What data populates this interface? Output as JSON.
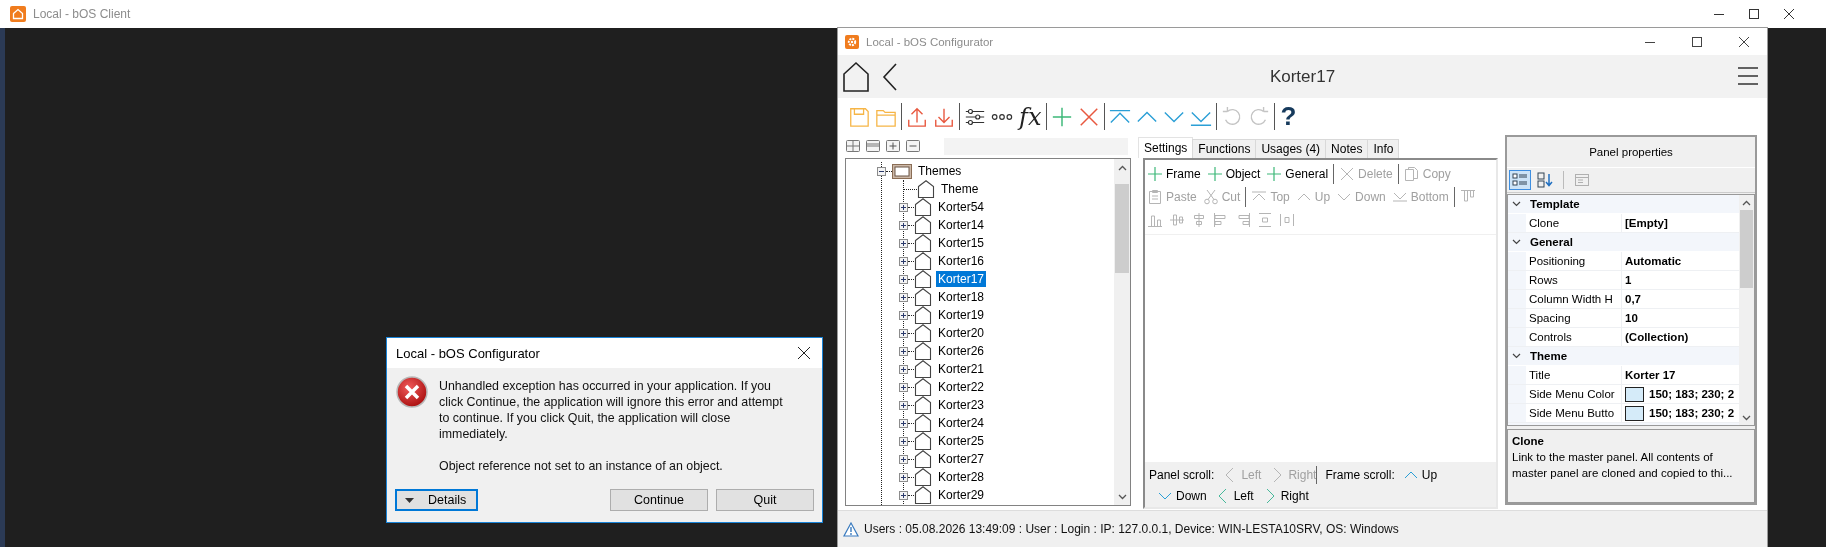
{
  "client_window": {
    "title": "Local - bOS Client"
  },
  "configurator": {
    "title": "Local - bOS Configurator",
    "header": {
      "title": "Korter17"
    },
    "toolbar": [
      [
        {
          "kind": "save",
          "disabled": false
        },
        {
          "kind": "open",
          "disabled": false
        }
      ],
      [
        {
          "kind": "upload",
          "disabled": false
        },
        {
          "kind": "download",
          "disabled": false
        }
      ],
      [
        {
          "kind": "sliders",
          "disabled": false
        },
        {
          "kind": "more",
          "disabled": false
        },
        {
          "kind": "function",
          "label": "fx",
          "disabled": false
        }
      ],
      [
        {
          "kind": "add",
          "disabled": false
        },
        {
          "kind": "remove",
          "disabled": false
        }
      ],
      [
        {
          "kind": "top",
          "disabled": false
        },
        {
          "kind": "up",
          "disabled": false
        },
        {
          "kind": "down",
          "disabled": false
        },
        {
          "kind": "bottom",
          "disabled": false
        }
      ],
      [
        {
          "kind": "undo",
          "disabled": true
        },
        {
          "kind": "redo",
          "disabled": true
        }
      ],
      [
        {
          "kind": "help",
          "label": "?",
          "disabled": false
        }
      ]
    ],
    "tree": [
      {
        "label": "Themes",
        "kind": "group",
        "expanded": true,
        "selected": false,
        "children": [
          {
            "label": "Theme",
            "kind": "panel",
            "selected": false
          },
          {
            "label": "Korter54",
            "kind": "panel",
            "expanded": false,
            "selected": false
          },
          {
            "label": "Korter14",
            "kind": "panel",
            "expanded": false,
            "selected": false
          },
          {
            "label": "Korter15",
            "kind": "panel",
            "expanded": false,
            "selected": false
          },
          {
            "label": "Korter16",
            "kind": "panel",
            "expanded": false,
            "selected": false
          },
          {
            "label": "Korter17",
            "kind": "panel",
            "expanded": false,
            "selected": true
          },
          {
            "label": "Korter18",
            "kind": "panel",
            "expanded": false,
            "selected": false
          },
          {
            "label": "Korter19",
            "kind": "panel",
            "expanded": false,
            "selected": false
          },
          {
            "label": "Korter20",
            "kind": "panel",
            "expanded": false,
            "selected": false
          },
          {
            "label": "Korter26",
            "kind": "panel",
            "expanded": false,
            "selected": false
          },
          {
            "label": "Korter21",
            "kind": "panel",
            "expanded": false,
            "selected": false
          },
          {
            "label": "Korter22",
            "kind": "panel",
            "expanded": false,
            "selected": false
          },
          {
            "label": "Korter23",
            "kind": "panel",
            "expanded": false,
            "selected": false
          },
          {
            "label": "Korter24",
            "kind": "panel",
            "expanded": false,
            "selected": false
          },
          {
            "label": "Korter25",
            "kind": "panel",
            "expanded": false,
            "selected": false
          },
          {
            "label": "Korter27",
            "kind": "panel",
            "expanded": false,
            "selected": false
          },
          {
            "label": "Korter28",
            "kind": "panel",
            "expanded": false,
            "selected": false
          },
          {
            "label": "Korter29",
            "kind": "panel",
            "expanded": false,
            "selected": false
          }
        ]
      }
    ],
    "tabs": [
      {
        "label": "Settings",
        "selected": true
      },
      {
        "label": "Functions",
        "selected": false
      },
      {
        "label": "Usages (4)",
        "selected": false
      },
      {
        "label": "Notes",
        "selected": false
      },
      {
        "label": "Info",
        "selected": false
      }
    ],
    "actions": [
      [
        [
          {
            "kind": "add",
            "label": "Frame",
            "disabled": false
          },
          {
            "kind": "add",
            "label": "Object",
            "disabled": false
          },
          {
            "kind": "add",
            "label": "General",
            "disabled": false
          }
        ],
        [
          {
            "kind": "delete",
            "label": "Delete",
            "disabled": true
          }
        ],
        [
          {
            "kind": "copy",
            "label": "Copy",
            "disabled": true
          }
        ]
      ],
      [
        [
          {
            "kind": "paste",
            "label": "Paste",
            "disabled": true
          },
          {
            "kind": "cut",
            "label": "Cut",
            "disabled": true
          }
        ],
        [
          {
            "kind": "top",
            "label": "Top",
            "disabled": true
          },
          {
            "kind": "up",
            "label": "Up",
            "disabled": true
          },
          {
            "kind": "down",
            "label": "Down",
            "disabled": true
          },
          {
            "kind": "bottom",
            "label": "Bottom",
            "disabled": true
          }
        ],
        [
          {
            "kind": "align-top",
            "disabled": true
          }
        ]
      ],
      [
        [
          {
            "kind": "align-bottom",
            "disabled": true
          },
          {
            "kind": "align-middle",
            "disabled": true
          },
          {
            "kind": "align-center",
            "disabled": true
          },
          {
            "kind": "align-left",
            "disabled": true
          },
          {
            "kind": "align-right",
            "disabled": true
          },
          {
            "kind": "space-vertical",
            "disabled": true
          },
          {
            "kind": "space-horizontal",
            "disabled": true
          }
        ]
      ]
    ],
    "scroll_controls": [
      {
        "label": "Panel scroll:",
        "items": [
          {
            "kind": "left",
            "label": "Left",
            "disabled": true
          },
          {
            "kind": "right",
            "label": "Right",
            "disabled": true
          }
        ]
      },
      {
        "label": "Frame scroll:",
        "items": [
          {
            "kind": "up",
            "label": "Up",
            "disabled": false
          },
          {
            "kind": "down",
            "label": "Down",
            "disabled": false
          },
          {
            "kind": "left",
            "label": "Left",
            "disabled": false
          },
          {
            "kind": "right",
            "label": "Right",
            "disabled": false
          }
        ]
      }
    ],
    "properties": {
      "title": "Panel properties",
      "sort_buttons": [
        {
          "kind": "categorized",
          "selected": true
        },
        {
          "kind": "alphabetical",
          "selected": false
        }
      ],
      "pages_button": {
        "disabled": true
      },
      "categories": [
        {
          "name": "Template",
          "expanded": true,
          "rows": [
            {
              "name": "Clone",
              "value": "[Empty]"
            }
          ]
        },
        {
          "name": "General",
          "expanded": true,
          "rows": [
            {
              "name": "Positioning",
              "value": "Automatic"
            },
            {
              "name": "Rows",
              "value": "1"
            },
            {
              "name": "Column Width H",
              "value": "0,7"
            },
            {
              "name": "Spacing",
              "value": "10"
            },
            {
              "name": "Controls",
              "value": "(Collection)"
            }
          ]
        },
        {
          "name": "Theme",
          "expanded": true,
          "rows": [
            {
              "name": "Title",
              "value": "Korter 17"
            },
            {
              "name": "Side Menu Color",
              "value": "150; 183; 230; 2",
              "color": "#d5ebf9"
            },
            {
              "name": "Side Menu Butto",
              "value": "150; 183; 230; 2",
              "color": "#d5ebf9"
            }
          ]
        }
      ],
      "description": {
        "title": "Clone",
        "text": "Link to the master panel. All contents of master panel are cloned and copied to thi..."
      }
    },
    "status_bar": {
      "text": "Users : 05.08.2026 13:49:09 : User : Login : IP: 127.0.0.1, Device: WIN-LESTA10SRV, OS: Windows"
    }
  },
  "dialog": {
    "title": "Local - bOS Configurator",
    "message": "Unhandled exception has occurred in your application. If you click Continue, the application will ignore this error and attempt to continue. If you click Quit, the application will close immediately.",
    "detail": "Object reference not set to an instance of an object.",
    "buttons": [
      {
        "kind": "details",
        "label": "Details",
        "focused": true
      },
      {
        "kind": "plain",
        "label": "Continue",
        "focused": false
      },
      {
        "kind": "plain",
        "label": "Quit",
        "focused": false
      }
    ]
  }
}
